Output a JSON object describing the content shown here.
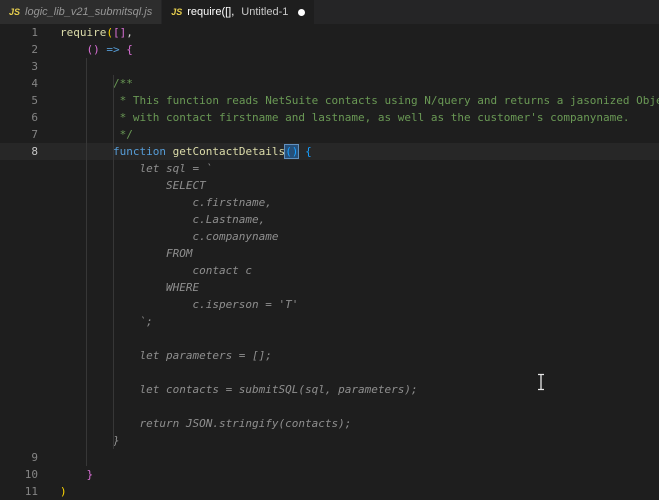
{
  "colors": {
    "bg": "#1e1e1e",
    "tabbar-bg": "#252526",
    "tab-inactive-bg": "#2d2d2d",
    "tab-active-bg": "#1e1e1e",
    "tab-inactive-fg": "#969696",
    "tab-active-fg": "#ffffff",
    "js-icon": "#e7cf4e",
    "fg": "#d4d4d4",
    "comment": "#6a9955",
    "keyword": "#569cd6",
    "function": "#dcdcaa",
    "bracket1": "#ffd700",
    "bracket2": "#da70d6",
    "bracket3": "#179fff",
    "ghost": "#8f8f8f",
    "line-number": "#858585",
    "line-number-active": "#c6c6c6",
    "bracket-match-bg": "#264f78",
    "bracket-match-border": "#6190bf"
  },
  "tabbar": {
    "tabs": [
      {
        "icon": "JS",
        "label": "logic_lib_v21_submitsql.js",
        "description": "",
        "active": false,
        "modified": false,
        "preview": true
      },
      {
        "icon": "JS",
        "label": "require([],",
        "description": "Untitled-1",
        "active": true,
        "modified": true,
        "preview": false
      }
    ]
  },
  "editor": {
    "rows": [
      {
        "num": "1",
        "tokens": [
          [
            "require",
            "fn"
          ],
          [
            "(",
            "b1"
          ],
          [
            "[]",
            "b2"
          ],
          [
            ",",
            "fg"
          ]
        ]
      },
      {
        "num": "2",
        "tokens": [
          [
            "    ",
            "fg"
          ],
          [
            "()",
            "b2"
          ],
          [
            " ",
            "fg"
          ],
          [
            "=>",
            "kw"
          ],
          [
            " ",
            "fg"
          ],
          [
            "{",
            "b2"
          ]
        ]
      },
      {
        "num": "3",
        "tokens": []
      },
      {
        "num": "4",
        "tokens": [
          [
            "        ",
            "fg"
          ],
          [
            "/**",
            "comment"
          ]
        ]
      },
      {
        "num": "5",
        "tokens": [
          [
            "         ",
            "fg"
          ],
          [
            "* This function reads NetSuite contacts using N/query and returns a jasonized Object",
            "comment"
          ]
        ]
      },
      {
        "num": "6",
        "tokens": [
          [
            "         ",
            "fg"
          ],
          [
            "* with contact firstname and lastname, as well as the customer's companyname.",
            "comment"
          ]
        ]
      },
      {
        "num": "7",
        "tokens": [
          [
            "         ",
            "fg"
          ],
          [
            "*/",
            "comment"
          ]
        ]
      },
      {
        "num": "8",
        "current": true,
        "tokens": [
          [
            "        ",
            "fg"
          ],
          [
            "function",
            "kw"
          ],
          [
            " ",
            "fg"
          ],
          [
            "getContactDetails",
            "fn"
          ],
          [
            "()",
            "b3-box"
          ],
          [
            " ",
            "fg"
          ],
          [
            "{",
            "b3"
          ]
        ]
      },
      {
        "num": "",
        "ghost": true,
        "tokens": [
          [
            "            let sql = `",
            "ghost"
          ]
        ]
      },
      {
        "num": "",
        "ghost": true,
        "tokens": [
          [
            "                SELECT",
            "ghost"
          ]
        ]
      },
      {
        "num": "",
        "ghost": true,
        "tokens": [
          [
            "                    c.firstname,",
            "ghost"
          ]
        ]
      },
      {
        "num": "",
        "ghost": true,
        "tokens": [
          [
            "                    c.Lastname,",
            "ghost"
          ]
        ]
      },
      {
        "num": "",
        "ghost": true,
        "tokens": [
          [
            "                    c.companyname",
            "ghost"
          ]
        ]
      },
      {
        "num": "",
        "ghost": true,
        "tokens": [
          [
            "                FROM",
            "ghost"
          ]
        ]
      },
      {
        "num": "",
        "ghost": true,
        "tokens": [
          [
            "                    contact c",
            "ghost"
          ]
        ]
      },
      {
        "num": "",
        "ghost": true,
        "tokens": [
          [
            "                WHERE",
            "ghost"
          ]
        ]
      },
      {
        "num": "",
        "ghost": true,
        "tokens": [
          [
            "                    c.isperson = 'T'",
            "ghost"
          ]
        ]
      },
      {
        "num": "",
        "ghost": true,
        "tokens": [
          [
            "            `;",
            "ghost"
          ]
        ]
      },
      {
        "num": "",
        "ghost": true,
        "tokens": []
      },
      {
        "num": "",
        "ghost": true,
        "tokens": [
          [
            "            let parameters = [];",
            "ghost"
          ]
        ]
      },
      {
        "num": "",
        "ghost": true,
        "tokens": []
      },
      {
        "num": "",
        "ghost": true,
        "tokens": [
          [
            "            let contacts = submitSQL(sql, parameters);",
            "ghost"
          ]
        ]
      },
      {
        "num": "",
        "ghost": true,
        "tokens": []
      },
      {
        "num": "",
        "ghost": true,
        "tokens": [
          [
            "            return JSON.stringify(contacts);",
            "ghost"
          ]
        ]
      },
      {
        "num": "",
        "ghost": true,
        "tokens": [
          [
            "        }",
            "ghost"
          ]
        ]
      },
      {
        "num": "9",
        "tokens": []
      },
      {
        "num": "10",
        "tokens": [
          [
            "    ",
            "fg"
          ],
          [
            "}",
            "b2"
          ]
        ]
      },
      {
        "num": "11",
        "tokens": [
          [
            ")",
            "b1"
          ]
        ]
      }
    ]
  },
  "mouse_cursor": {
    "shape": "i-beam"
  }
}
